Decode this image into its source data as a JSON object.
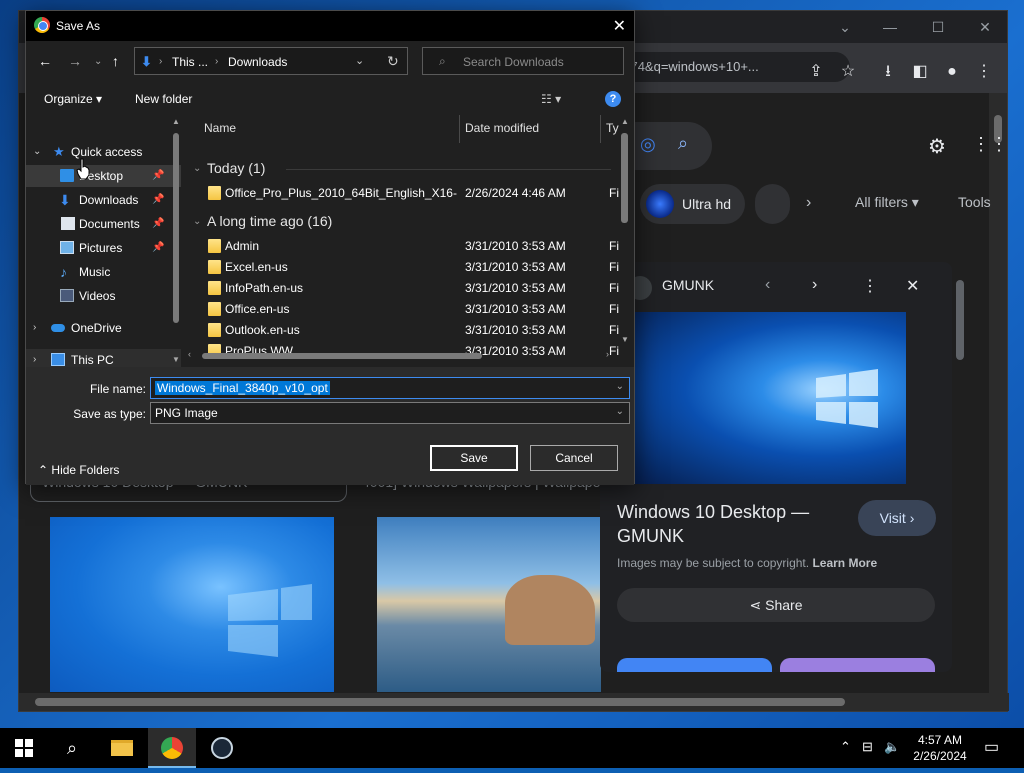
{
  "chrome": {
    "url_fragment": "1074&q=windows+10+...",
    "filter_chip_label": "Ultra hd",
    "all_filters_label": "All filters",
    "tools_label": "Tools",
    "panel": {
      "source": "GMUNK",
      "title": "Windows 10 Desktop — GMUNK",
      "visit_label": "Visit",
      "copyright_text": "Images may be subject to copyright.",
      "learn_more": "Learn More",
      "share_label": "Share"
    },
    "results": [
      {
        "caption": "Windows 10 Desktop — GMUNK"
      },
      {
        "caption": "4001] Windows Wallpapers | Wallpaper"
      }
    ]
  },
  "dialog": {
    "title": "Save As",
    "breadcrumb": [
      "This ...",
      "Downloads"
    ],
    "search_placeholder": "Search Downloads",
    "organize_label": "Organize",
    "new_folder_label": "New folder",
    "help_glyph": "?",
    "nav_tree": [
      {
        "label": "Quick access",
        "icon": "star-icon",
        "pinned": false
      },
      {
        "label": "Desktop",
        "icon": "desktop-icon",
        "pinned": true
      },
      {
        "label": "Downloads",
        "icon": "download-icon",
        "pinned": true
      },
      {
        "label": "Documents",
        "icon": "documents-icon",
        "pinned": true
      },
      {
        "label": "Pictures",
        "icon": "pictures-icon",
        "pinned": true
      },
      {
        "label": "Music",
        "icon": "music-icon",
        "pinned": false
      },
      {
        "label": "Videos",
        "icon": "videos-icon",
        "pinned": false
      },
      {
        "label": "OneDrive",
        "icon": "cloud-icon",
        "pinned": false
      },
      {
        "label": "This PC",
        "icon": "computer-icon",
        "pinned": false
      }
    ],
    "columns": {
      "name": "Name",
      "date": "Date modified",
      "type": "Ty"
    },
    "groups": [
      {
        "label": "Today (1)",
        "files": [
          {
            "name": "Office_Pro_Plus_2010_64Bit_English_X16-...",
            "date": "2/26/2024 4:46 AM",
            "type": "Fi"
          }
        ]
      },
      {
        "label": "A long time ago (16)",
        "files": [
          {
            "name": "Admin",
            "date": "3/31/2010 3:53 AM",
            "type": "Fi"
          },
          {
            "name": "Excel.en-us",
            "date": "3/31/2010 3:53 AM",
            "type": "Fi"
          },
          {
            "name": "InfoPath.en-us",
            "date": "3/31/2010 3:53 AM",
            "type": "Fi"
          },
          {
            "name": "Office.en-us",
            "date": "3/31/2010 3:53 AM",
            "type": "Fi"
          },
          {
            "name": "Outlook.en-us",
            "date": "3/31/2010 3:53 AM",
            "type": "Fi"
          },
          {
            "name": "ProPlus.WW",
            "date": "3/31/2010 3:53 AM",
            "type": "Fi"
          }
        ]
      }
    ],
    "file_name_label": "File name:",
    "file_name_value": "Windows_Final_3840p_v10_opt",
    "save_as_type_label": "Save as type:",
    "save_as_type_value": "PNG Image",
    "save_label": "Save",
    "cancel_label": "Cancel",
    "hide_folders_label": "Hide Folders"
  },
  "taskbar": {
    "time": "4:57 AM",
    "date": "2/26/2024"
  }
}
